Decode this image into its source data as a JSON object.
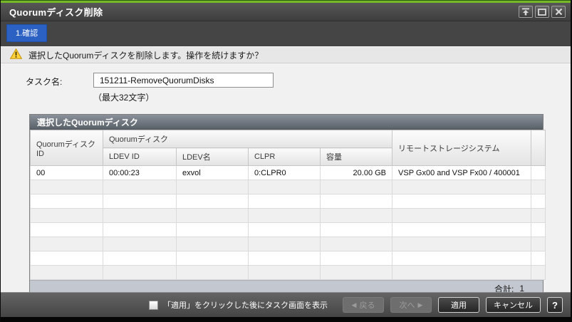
{
  "window": {
    "title": "Quorumディスク削除",
    "step_label": "1.確認",
    "icons": {
      "rollup": "collapse-to-top",
      "maximize": "restore-window",
      "close": "close-window"
    }
  },
  "warning": {
    "message": "選択したQuorumディスクを削除します。操作を続けますか？"
  },
  "task": {
    "label": "タスク名:",
    "value": "151211-RemoveQuorumDisks",
    "hint": "（最大32文字）"
  },
  "table": {
    "title": "選択したQuorumディスク",
    "group_header": "Quorumディスク",
    "headers": {
      "quorum_id": "QuorumディスクID",
      "ldev_id": "LDEV ID",
      "ldev_name": "LDEV名",
      "clpr": "CLPR",
      "capacity": "容量",
      "remote": "リモートストレージシステム"
    },
    "rows": [
      {
        "quorum_id": "00",
        "ldev_id": "00:00:23",
        "ldev_name": "exvol",
        "clpr": "0:CLPR0",
        "capacity": "20.00 GB",
        "remote": "VSP Gx00 and VSP Fx00 / 400001"
      }
    ],
    "total_label": "合計:",
    "total_value": "1"
  },
  "footer": {
    "checkbox_label": "「適用」をクリックした後にタスク画面を表示",
    "checkbox_checked": false,
    "back_icon": "◀",
    "back_label": "戻る",
    "next_label": "次へ",
    "next_icon": "▶",
    "apply_label": "適用",
    "cancel_label": "キャンセル",
    "help_label": "?"
  },
  "colors": {
    "brand_green": "#76b82a",
    "step_tab_blue": "#2b61c3",
    "titlebar_gray": "#454545",
    "panel_header_slate": "#5b6169",
    "table_footer_bar": "#c3c7d0",
    "warning_yellow": "#fdd23a"
  }
}
